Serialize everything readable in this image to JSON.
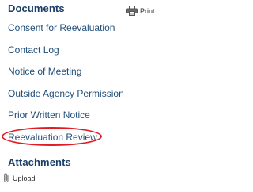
{
  "documents": {
    "title": "Documents",
    "print_label": "Print",
    "items": [
      {
        "label": "Consent for Reevaluation"
      },
      {
        "label": "Contact Log"
      },
      {
        "label": "Notice of Meeting"
      },
      {
        "label": "Outside Agency Permission"
      },
      {
        "label": "Prior Written Notice"
      },
      {
        "label": "Reevaluation Review"
      }
    ]
  },
  "attachments": {
    "title": "Attachments",
    "upload_label": "Upload"
  },
  "icons": {
    "print": "printer-icon",
    "upload": "paperclip-icon"
  },
  "colors": {
    "link": "#1f4e79",
    "heading": "#1b3f66",
    "highlight": "#e11b22"
  }
}
